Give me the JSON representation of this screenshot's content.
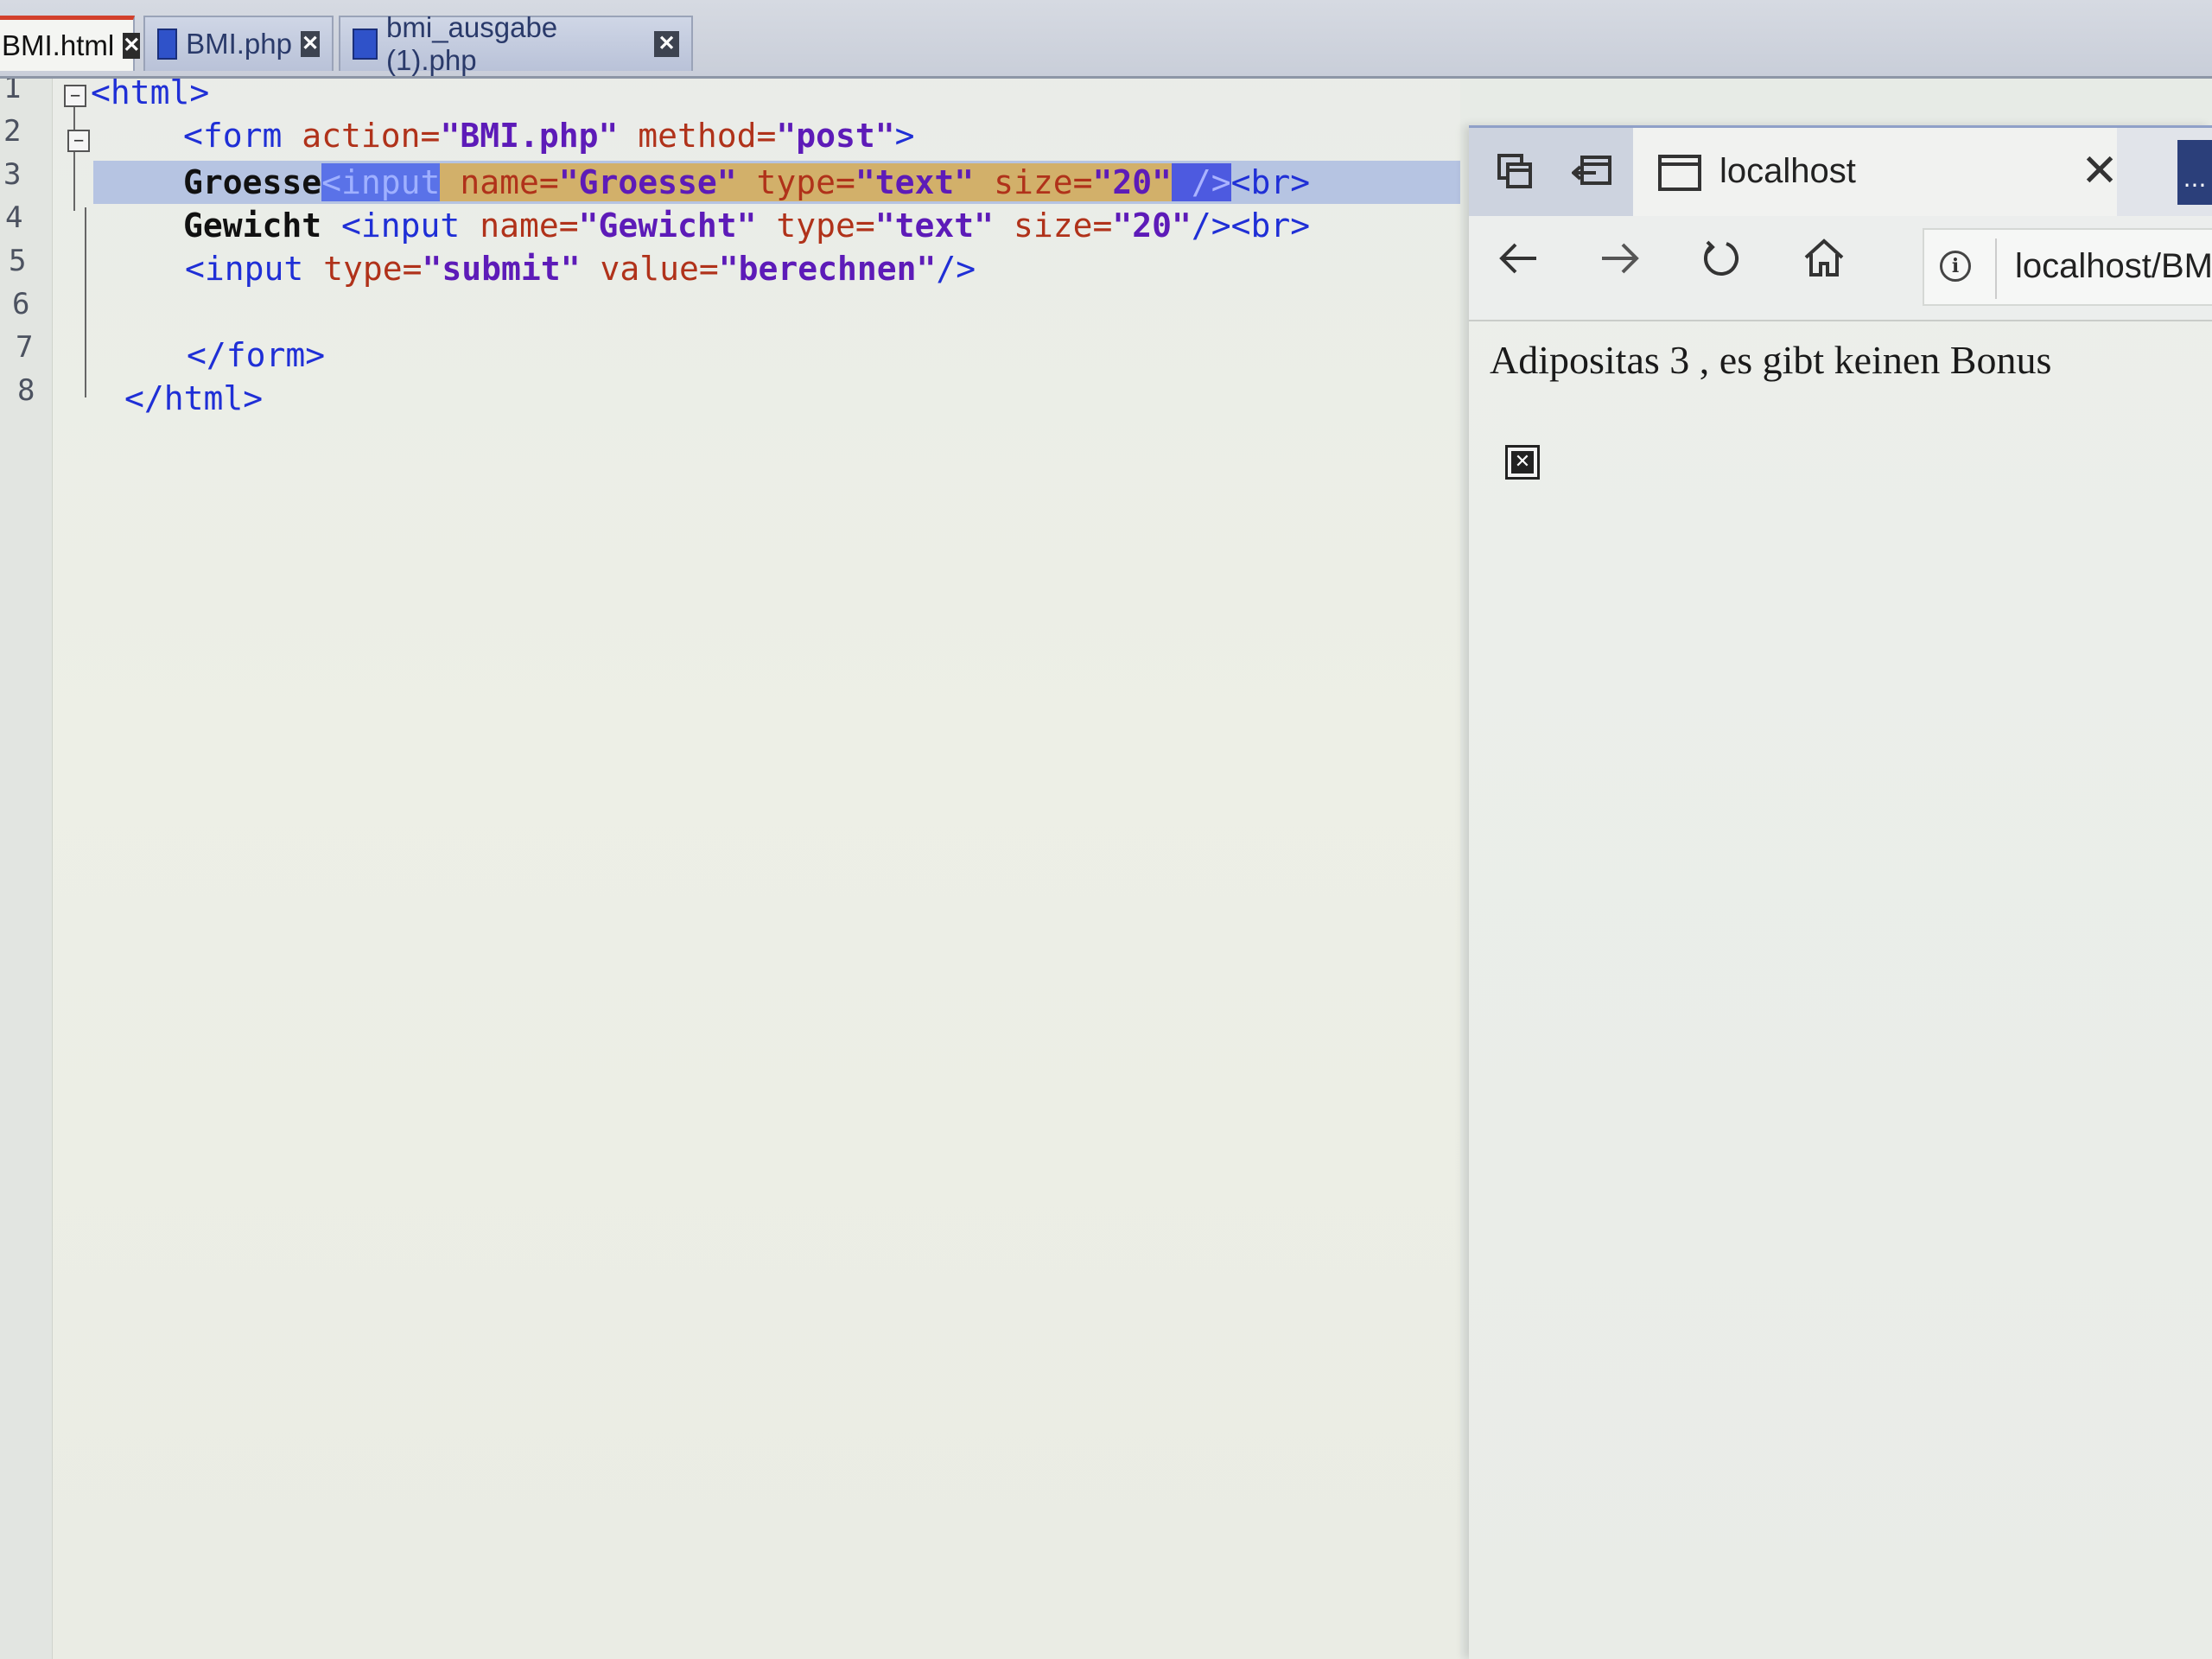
{
  "editor": {
    "tabs": [
      {
        "label": "BMI.html",
        "active": true
      },
      {
        "label": "BMI.php",
        "active": false
      },
      {
        "label": "bmi_ausgabe (1).php",
        "active": false
      }
    ],
    "line_numbers": [
      "1",
      "2",
      "3",
      "4",
      "5",
      "6",
      "7",
      "8"
    ],
    "code": {
      "l1_tag": "<html>",
      "l2_tag_open": "<form ",
      "l2_attr1": "action=",
      "l2_val1": "\"BMI.php\"",
      "l2_attr2": " method=",
      "l2_val2": "\"post\"",
      "l2_tag_close": ">",
      "l3_plain": "Groesse",
      "l3_tag_open": "<input",
      "l3_attr1": " name=",
      "l3_val1": "\"Groesse\"",
      "l3_attr2": " type=",
      "l3_val2": "\"text\"",
      "l3_attr3": " size=",
      "l3_val3": "\"20\"",
      "l3_tag_close": " />",
      "l3_br": "<br>",
      "l4_plain": "Gewicht ",
      "l4_tag_open": "<input",
      "l4_attr1": " name=",
      "l4_val1": "\"Gewicht\"",
      "l4_attr2": " type=",
      "l4_val2": "\"text\"",
      "l4_attr3": " size=",
      "l4_val3": "\"20\"",
      "l4_tag_close": "/><br>",
      "l5_tag_open": "<input ",
      "l5_attr1": "type=",
      "l5_val1": "\"submit\"",
      "l5_attr2": " value=",
      "l5_val2": "\"berechnen\"",
      "l5_tag_close": "/>",
      "l7_tag": "</form>",
      "l8_tag": "</html>"
    }
  },
  "browser": {
    "tab_title": "localhost",
    "address": "localhost/BMI",
    "content": "Adipositas 3 , es gibt keinen Bonus",
    "more_label": "..."
  },
  "colors": {
    "tag": "#1f2fd6",
    "attr": "#b0321a",
    "value": "#5d1bb8",
    "line_highlight": "#b6c4e2",
    "active_tab_accent": "#d2402b"
  }
}
